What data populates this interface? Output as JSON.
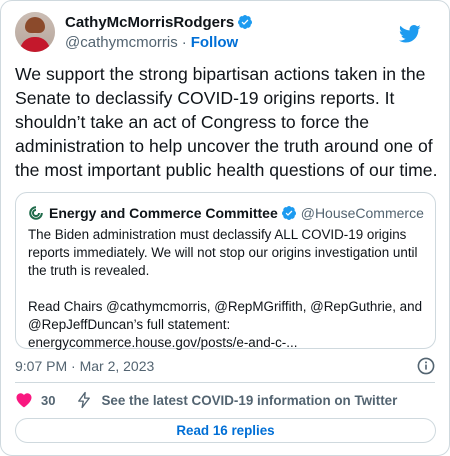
{
  "author": {
    "display_name": "CathyMcMorrisRodgers",
    "handle": "@cathymcmorris",
    "separator": "·",
    "follow_label": "Follow"
  },
  "tweet": {
    "text": "We support the strong bipartisan actions taken in the Senate to declassify COVID-19 origins reports. It shouldn’t take an act of Congress to force the administration to help uncover the truth around one of the most important public health questions of our time."
  },
  "quoted_tweet": {
    "display_name": "Energy and Commerce Committee",
    "handle": "@HouseCommerce",
    "paragraph1": "The Biden administration must declassify ALL COVID-19 origins reports immediately. We will not stop our origins investigation until the truth is revealed.",
    "paragraph2_line1": "Read Chairs @cathymcmorris, @RepMGriffith, @RepGuthrie, and",
    "paragraph2_line2": "@RepJeffDuncan’s full statement:",
    "paragraph2_line3": "energycommerce.house.gov/posts/e-and-c-..."
  },
  "timestamp": "9:07 PM · Mar 2, 2023",
  "actions": {
    "like_count": "30",
    "covid_info_link": "See the latest COVID-19 information on Twitter",
    "read_replies": "Read 16 replies"
  },
  "colors": {
    "twitter_blue": "#1d9bf0",
    "link_blue": "#006fd6",
    "heart_red": "#f91880",
    "committee_green": "#1f6b4a"
  },
  "icons": [
    "verified-badge-icon",
    "twitter-bird-icon",
    "committee-logo-icon",
    "info-icon",
    "heart-icon",
    "bolt-icon"
  ]
}
